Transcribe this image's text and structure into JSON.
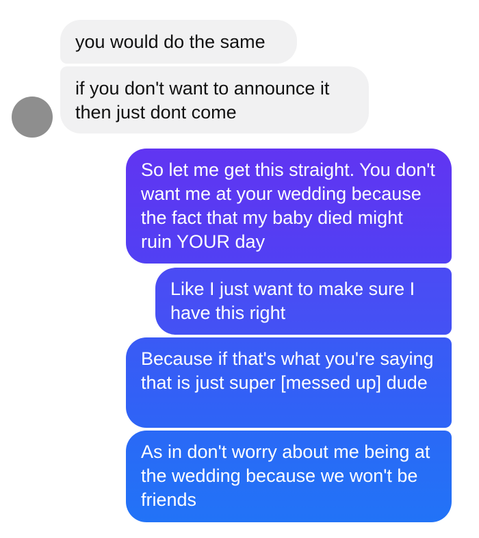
{
  "colors": {
    "background": "#ffffff",
    "incoming_bubble": "#f1f1f2",
    "incoming_text": "#111111",
    "outgoing_text": "#ffffff",
    "outgoing_gradient_top": "#6135f2",
    "outgoing_gradient_bottom": "#2273f7",
    "avatar": "#8e8e8e"
  },
  "messages": [
    {
      "direction": "incoming",
      "text": "you would do the same"
    },
    {
      "direction": "incoming",
      "text": "if you don't want to announce it then just dont come"
    },
    {
      "direction": "outgoing",
      "text": "So let me get this straight. You don't want me at your wedding because the fact that my baby died might ruin YOUR day"
    },
    {
      "direction": "outgoing",
      "text": "Like I just want to make sure I have this right"
    },
    {
      "direction": "outgoing",
      "text": "Because if that's what you're saying that is just super [messed up] dude"
    },
    {
      "direction": "outgoing",
      "text": "As in don't worry about me being at the wedding because we won't be friends"
    }
  ]
}
